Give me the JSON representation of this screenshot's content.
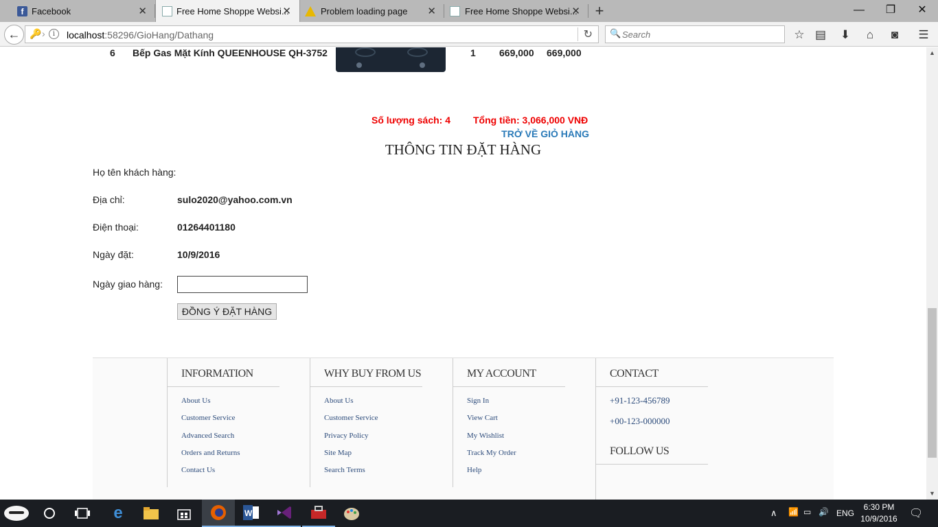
{
  "browser": {
    "tabs": [
      {
        "title": "Facebook",
        "icon": "facebook-icon"
      },
      {
        "title": "Free Home Shoppe Websi...",
        "icon": "page-icon"
      },
      {
        "title": "Problem loading page",
        "icon": "warning-icon"
      },
      {
        "title": "Free Home Shoppe Websi...",
        "icon": "page-icon"
      }
    ],
    "url_host": "localhost",
    "url_rest": ":58296/GioHang/Dathang",
    "search_placeholder": "Search"
  },
  "cart_row": {
    "index": "6",
    "name": "Bếp Gas Mặt Kính QUEENHOUSE QH-3752",
    "quantity": "1",
    "unit_price": "669,000",
    "total": "669,000"
  },
  "summary": {
    "count_text": "Số lượng sách: 4",
    "total_text": "Tổng tiền: 3,066,000 VNĐ",
    "back_link": "TRỞ VỀ GIỎ HÀNG"
  },
  "order": {
    "title": "THÔNG TIN ĐẶT HÀNG",
    "name_label": "Họ tên khách hàng:",
    "address_label": "Địa chỉ:",
    "address_value": "sulo2020@yahoo.com.vn",
    "phone_label": "Điện thoại:",
    "phone_value": "01264401180",
    "order_date_label": "Ngày đặt:",
    "order_date_value": "10/9/2016",
    "delivery_label": "Ngày giao hàng:",
    "delivery_value": "",
    "submit_label": "ĐỒNG Ý ĐẶT HÀNG"
  },
  "footer": {
    "information": {
      "title": "INFORMATION",
      "links": [
        "About Us",
        "Customer Service",
        "Advanced Search",
        "Orders and Returns",
        "Contact Us"
      ]
    },
    "why_buy": {
      "title": "WHY BUY FROM US",
      "links": [
        "About Us",
        "Customer Service",
        "Privacy Policy",
        "Site Map",
        "Search Terms"
      ]
    },
    "account": {
      "title": "MY ACCOUNT",
      "links": [
        "Sign In",
        "View Cart",
        "My Wishlist",
        "Track My Order",
        "Help"
      ]
    },
    "contact": {
      "title": "CONTACT",
      "phone1": "+91-123-456789",
      "phone2": "+00-123-000000",
      "follow_title": "FOLLOW US"
    }
  },
  "taskbar": {
    "lang": "ENG",
    "time": "6:30 PM",
    "date": "10/9/2016"
  }
}
